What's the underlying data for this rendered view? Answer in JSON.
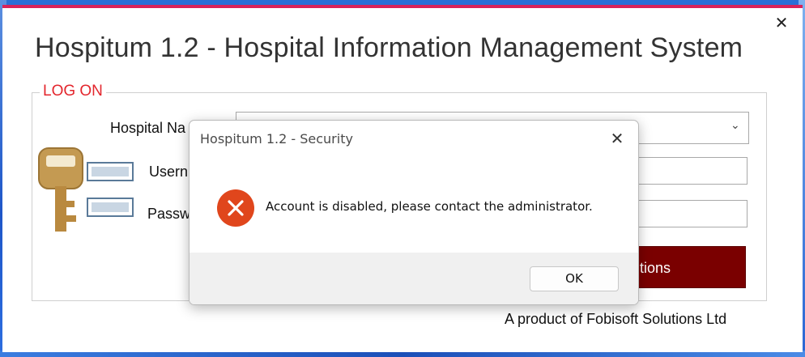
{
  "app": {
    "title": "Hospitum 1.2 - Hospital Information Management System",
    "close_glyph": "✕",
    "accent_color": "#d8235a"
  },
  "logon": {
    "legend": "LOG ON",
    "hospital_label": "Hospital Na",
    "username_label": "Usern",
    "password_label": "Passw",
    "button_label": "tions",
    "dropdown_chevron": "⌄"
  },
  "footer": {
    "product": "A product of Fobisoft Solutions Ltd"
  },
  "dialog": {
    "title": "Hospitum 1.2 - Security",
    "close_glyph": "✕",
    "message": "Account is disabled, please contact the administrator.",
    "ok_label": "OK",
    "error_color": "#e0461c"
  },
  "icons": {
    "key": "key-icon",
    "username_field": "field-icon",
    "password_field": "field-icon",
    "error": "error-icon"
  }
}
